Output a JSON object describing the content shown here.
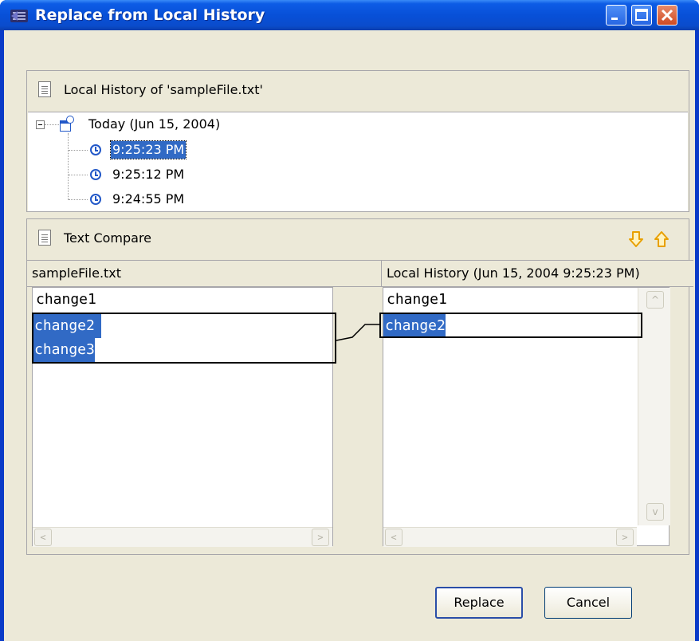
{
  "window": {
    "title": "Replace from Local History",
    "app_icon": "eclipse-icon",
    "controls": {
      "minimize": "minimize-icon",
      "maximize": "maximize-icon",
      "close": "close-icon"
    }
  },
  "history_pane": {
    "title": "Local History of 'sampleFile.txt'",
    "icon": "document-icon",
    "group_label": "Today (Jun 15, 2004)",
    "entries": [
      {
        "label": "9:25:23 PM",
        "selected": true
      },
      {
        "label": "9:25:12 PM",
        "selected": false
      },
      {
        "label": "9:24:55 PM",
        "selected": false
      }
    ]
  },
  "compare_pane": {
    "title": "Text Compare",
    "icon": "document-icon",
    "next_diff_icon": "arrow-down-icon",
    "prev_diff_icon": "arrow-up-icon",
    "left": {
      "header": "sampleFile.txt",
      "lines": [
        "change1",
        "change2",
        "change3"
      ]
    },
    "right": {
      "header": "Local History (Jun 15, 2004 9:25:23 PM)",
      "lines": [
        "change1",
        "change2"
      ]
    }
  },
  "buttons": {
    "replace": "Replace",
    "cancel": "Cancel"
  },
  "colors": {
    "selection": "#316ac5",
    "titlebar": "#0a4ccc",
    "dialog_bg": "#ece9d8",
    "diff_arrows": "#e8a000"
  }
}
